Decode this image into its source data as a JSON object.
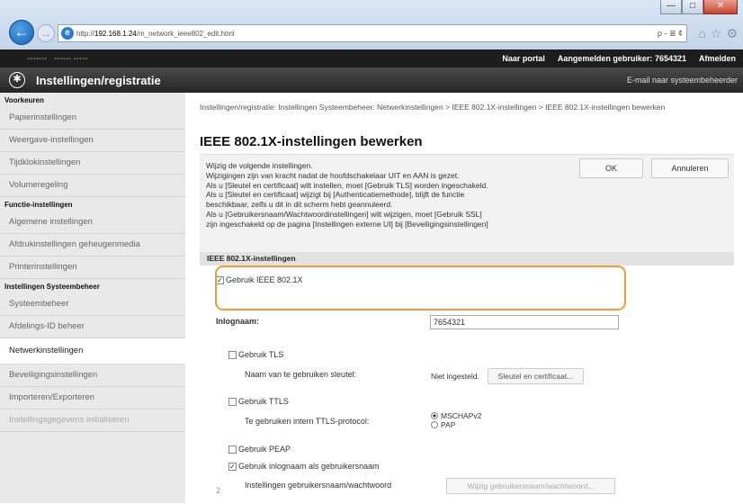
{
  "browser": {
    "window_controls": [
      "—",
      "□",
      "✕"
    ],
    "url_prefix": "http://",
    "url_host": "192.168.1.24",
    "url_path": "/m_network_ieee802_edit.html",
    "address_tools": "ρ - ≣ ¢"
  },
  "topbar": {
    "portal_link": "Naar portal",
    "logged_in_label": "Aangemelden gebruiker:",
    "user_id": "7654321",
    "logout_link": "Afmelden"
  },
  "header": {
    "title": "Instellingen/registratie",
    "admin_link": "E-mail naar systeembeheerder"
  },
  "sidebar": {
    "section1": "Voorkeuren",
    "items1": [
      "Papierinstellingen",
      "Weergave-instellingen",
      "Tijdklokinstellingen",
      "Volumeregeling"
    ],
    "section2": "Functie-instellingen",
    "items2": [
      "Algemene instellingen",
      "Afdrukinstellingen geheugenmedia",
      "Printerinstellingen"
    ],
    "section3": "Instellingen Systeembeheer",
    "items3": [
      "Systeembeheer",
      "Afdelings-ID beheer",
      "Netwerkinstellingen",
      "Beveiligingsinstellingen",
      "Importeren/Exporteren",
      "Instellingsgegevens initialiseren"
    ]
  },
  "main": {
    "breadcrumb": "Instellingen/registratie: Instellingen Systeembeheer: Netwerkinstellingen > IEEE 802.1X-instellingen > IEEE 802.1X-instellingen bewerken",
    "page_title": "IEEE 802.1X-instellingen bewerken",
    "instructions": [
      "Wijzig de volgende instellingen.",
      "Wijzigingen zijn van kracht nadat de hoofdschakelaar UIT en AAN is gezet.",
      "Als u [Sleutel en certificaat] wilt instellen, moet [Gebruik TLS] worden ingeschakeld.",
      "Als u [Sleutel en certificaat] wijzigt bij [Authenticatiemethode], blijft de functie",
      "beschikbaar, zelfs u dit in dit scherm hebt geannuleerd.",
      "Als u [Gebruikersnaam/Wachtwoordinstellingen] wilt wijzigen, moet [Gebruik SSL]",
      "zijn ingeschakeld op de pagina [Instellingen externe UI] bij [Beveiligingsinstellingen]"
    ],
    "ok_button": "OK",
    "cancel_button": "Annuleren",
    "section_title": "IEEE 802.1X-instellingen",
    "use_ieee_label": "Gebruik IEEE 802.1X",
    "login_name_label": "Inlognaam:",
    "login_name_value": "7654321",
    "use_tls_label": "Gebruik TLS",
    "key_name_label": "Naam van te gebruiken sleutel:",
    "key_status": "Niet ingesteld.",
    "key_cert_button": "Sleutel en certificaat...",
    "use_ttls_label": "Gebruik TTLS",
    "ttls_protocol_label": "Te gebruiken intern TTLS-protocol:",
    "mschap_label": "MSCHAPv2",
    "pap_label": "PAP",
    "use_peap_label": "Gebruik PEAP",
    "use_login_as_user_label": "Gebruik inlognaam als gebruikersnaam",
    "user_pw_settings_label": "Instellingen gebruikersnaam/wachtwoord",
    "change_user_pw_button": "Wijzig gebruikersnaam/wachtwoord..."
  },
  "footer": {
    "page_number": "2"
  },
  "colors": {
    "highlight": "#f29b3b",
    "header_bg": "#252525",
    "sidebar_bg": "#e9e9e9"
  }
}
